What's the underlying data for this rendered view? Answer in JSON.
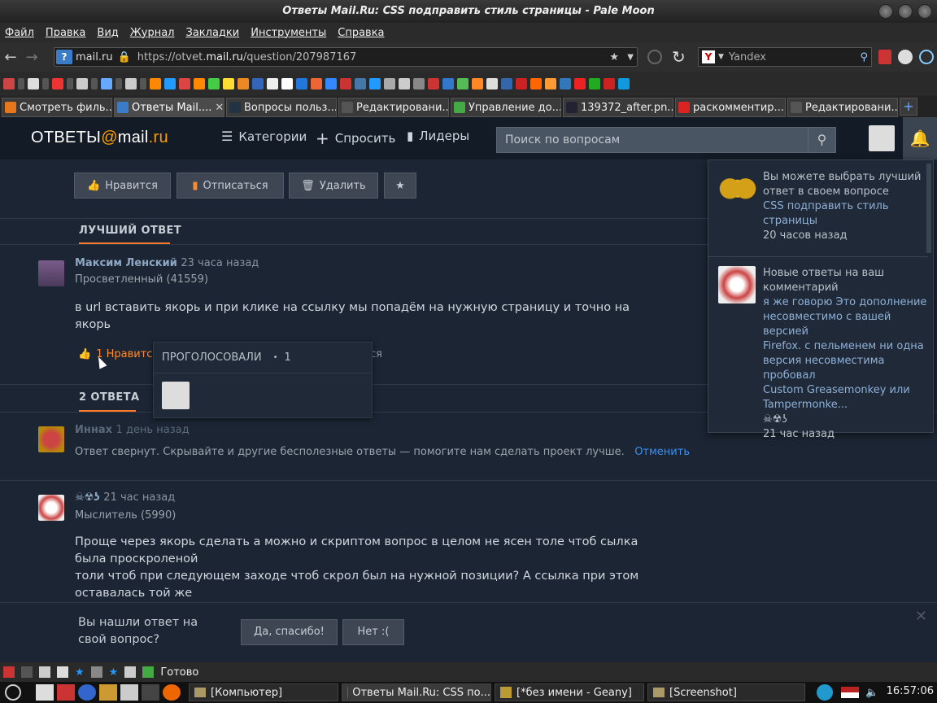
{
  "window": {
    "title": "Ответы Mail.Ru: CSS подправить стиль страницы - Pale Moon"
  },
  "menu": [
    "Файл",
    "Правка",
    "Вид",
    "Журнал",
    "Закладки",
    "Инструменты",
    "Справка"
  ],
  "nav": {
    "host": "mail.ru",
    "url_prefix": "https://otvet.",
    "url_host": "mail.ru",
    "url_path": "/question/207987167",
    "search_placeholder": "Yandex"
  },
  "tabs": [
    {
      "label": "Смотреть филь...",
      "color": "#e8761a"
    },
    {
      "label": "Ответы Mail....",
      "color": "#3a7cc7",
      "active": true
    },
    {
      "label": "Вопросы польз...",
      "color": "#234"
    },
    {
      "label": "Редактировани...",
      "color": "#555"
    },
    {
      "label": "Управление до...",
      "color": "#4a4"
    },
    {
      "label": "139372_after.pn...",
      "color": "#223"
    },
    {
      "label": "раскомментир...",
      "color": "#d22"
    },
    {
      "label": "Редактировани...",
      "color": "#555"
    }
  ],
  "site": {
    "logo_left": "ОТВЕТЫ",
    "logo_at": "@",
    "logo_right": "mail",
    "logo_tld": ".ru",
    "nav_categories": "Категории",
    "nav_ask": "Спросить",
    "nav_leaders": "Лидеры",
    "search_placeholder": "Поиск по вопросам"
  },
  "actions": {
    "like": "Нравится",
    "unsubscribe": "Отписаться",
    "delete": "Удалить"
  },
  "best_answer": {
    "heading": "ЛУЧШИЙ ОТВЕТ",
    "author": "Максим Ленский",
    "time": "23 часа назад",
    "rank": "Просветленный (41559)",
    "text_line1": "в url вставить якорь и при клике на ссылку мы попадём на нужную страницу и точно на",
    "text_line2": "якорь",
    "likes": "1 Нравится",
    "likes_trail": "ся"
  },
  "voters_popup": {
    "title": "ПРОГОЛОСОВАЛИ",
    "count": "1"
  },
  "answers": {
    "heading": "2 ОТВЕТА",
    "a1_author": "Иннах",
    "a1_time": "1 день назад",
    "a1_collapsed": "Ответ свернут. Скрывайте и другие бесполезные ответы — помогите нам сделать проект лучше.",
    "a1_cancel": "Отменить",
    "a2_author": "☠☢ʖ",
    "a2_time": "21 час назад",
    "a2_rank": "Мыслитель (5990)",
    "a2_line1": "Проще через якорь сделать а можно и скриптом вопрос в целом не ясен толе чтоб сылка",
    "a2_line2": "была проскроленой",
    "a2_line3": "толи чтоб при следующем заходе чтоб скрол был на нужной позиции? А ссылка при этом",
    "a2_line4": "оставалась той же"
  },
  "notifications": {
    "n1_title1": "Вы можете выбрать лучший",
    "n1_title2": "ответ в своем вопросе",
    "n1_link1": "CSS подправить стиль",
    "n1_link2": "страницы",
    "n1_time": "20 часов назад",
    "n2_title1": "Новые ответы на ваш",
    "n2_title2": "комментарий",
    "n2_l1": "я же говорю Это дополнение",
    "n2_l2": "несовместимо с вашей версией",
    "n2_l3": "Firefox. с пельменем ни одна",
    "n2_l4": "версия несовместима пробовал",
    "n2_l5": "Custom Greasemonkey или",
    "n2_l6": "Tampermonke...",
    "n2_sig": "☠☢ʖ",
    "n2_time": "21 час назад"
  },
  "feedback": {
    "q1": "Вы нашли ответ на",
    "q2": "свой вопрос?",
    "yes": "Да, спасибо!",
    "no": "Нет :("
  },
  "status": {
    "text": "Готово"
  },
  "taskbar": {
    "t1": "[Компьютер]",
    "t2": "Ответы Mail.Ru: CSS по...",
    "t3": "[*без имени - Geany]",
    "t4": "[Screenshot]",
    "clock": "16:57:06"
  }
}
